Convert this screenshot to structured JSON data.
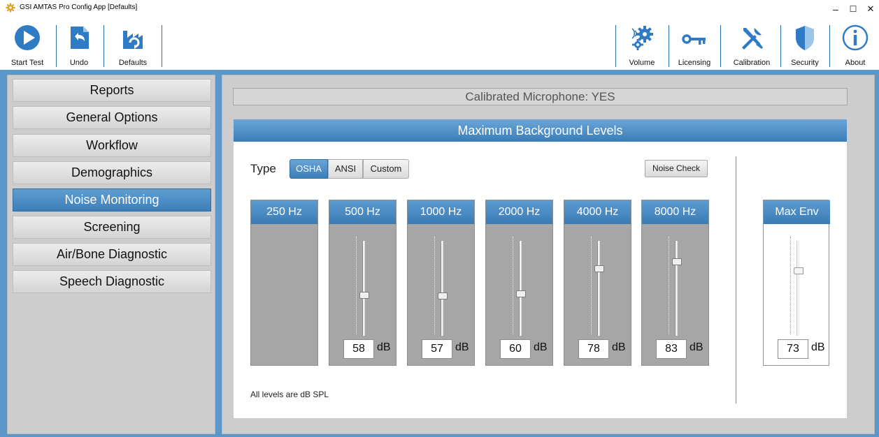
{
  "window": {
    "title": "GSI AMTAS Pro Config App [Defaults]",
    "controls": {
      "minimize": "–",
      "maximize": "☐",
      "close": "✕"
    }
  },
  "toolbar": {
    "left": [
      {
        "label": "Start Test",
        "icon": "play-icon"
      },
      {
        "label": "Undo",
        "icon": "undo-icon"
      },
      {
        "label": "Defaults",
        "icon": "factory-defaults-icon"
      }
    ],
    "right": [
      {
        "label": "Volume",
        "icon": "volume-gears-icon"
      },
      {
        "label": "Licensing",
        "icon": "key-icon"
      },
      {
        "label": "Calibration",
        "icon": "tools-icon"
      },
      {
        "label": "Security",
        "icon": "shield-icon"
      },
      {
        "label": "About",
        "icon": "info-icon"
      }
    ]
  },
  "sidebar": {
    "items": [
      {
        "label": "Reports",
        "active": false
      },
      {
        "label": "General Options",
        "active": false
      },
      {
        "label": "Workflow",
        "active": false
      },
      {
        "label": "Demographics",
        "active": false
      },
      {
        "label": "Noise Monitoring",
        "active": true
      },
      {
        "label": "Screening",
        "active": false
      },
      {
        "label": "Air/Bone Diagnostic",
        "active": false
      },
      {
        "label": "Speech Diagnostic",
        "active": false
      }
    ]
  },
  "main": {
    "calibrated_microphone": "Calibrated Microphone: YES",
    "panel_title": "Maximum Background Levels",
    "type_label": "Type",
    "type_options": [
      "OSHA",
      "ANSI",
      "Custom"
    ],
    "type_selected": "OSHA",
    "noise_check_label": "Noise Check",
    "bands": [
      {
        "label": "250 Hz",
        "enabled": false,
        "value": null,
        "unit": ""
      },
      {
        "label": "500 Hz",
        "enabled": true,
        "value": "58",
        "unit": "dB",
        "level": 0.42
      },
      {
        "label": "1000 Hz",
        "enabled": true,
        "value": "57",
        "unit": "dB",
        "level": 0.41
      },
      {
        "label": "2000 Hz",
        "enabled": true,
        "value": "60",
        "unit": "dB",
        "level": 0.44
      },
      {
        "label": "4000 Hz",
        "enabled": true,
        "value": "78",
        "unit": "dB",
        "level": 0.72
      },
      {
        "label": "8000 Hz",
        "enabled": true,
        "value": "83",
        "unit": "dB",
        "level": 0.8
      }
    ],
    "max_env": {
      "label": "Max Env",
      "value": "73",
      "unit": "dB",
      "level": 0.7
    },
    "footnote": "All levels are dB SPL"
  },
  "colors": {
    "accent_blue": "#3c7db8",
    "frame_blue": "#5b97c8",
    "panel_gray": "#cdcdcd",
    "band_gray": "#a6a6a6"
  }
}
